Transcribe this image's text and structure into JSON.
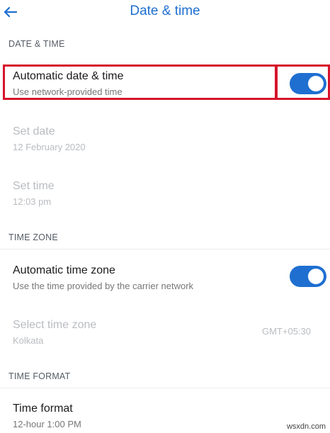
{
  "header": {
    "title": "Date & time",
    "back_icon": "arrow-left-icon"
  },
  "colors": {
    "accent": "#1f6fd1",
    "highlight": "#d6142b",
    "disabled_text": "#b9bcc0"
  },
  "sections": {
    "date_time": {
      "header": "DATE & TIME",
      "automatic": {
        "title": "Automatic date & time",
        "subtitle": "Use network-provided time",
        "enabled": true
      },
      "set_date": {
        "title": "Set date",
        "value": "12 February 2020"
      },
      "set_time": {
        "title": "Set time",
        "value": "12:03 pm"
      }
    },
    "time_zone": {
      "header": "TIME ZONE",
      "automatic": {
        "title": "Automatic time zone",
        "subtitle": "Use the time provided by the carrier network",
        "enabled": true
      },
      "select": {
        "title": "Select time zone",
        "subtitle": "Kolkata",
        "value": "GMT+05:30"
      }
    },
    "time_format": {
      "header": "TIME FORMAT",
      "format": {
        "title": "Time format",
        "subtitle": "12-hour 1:00 PM"
      }
    }
  },
  "watermark": "wsxdn.com"
}
